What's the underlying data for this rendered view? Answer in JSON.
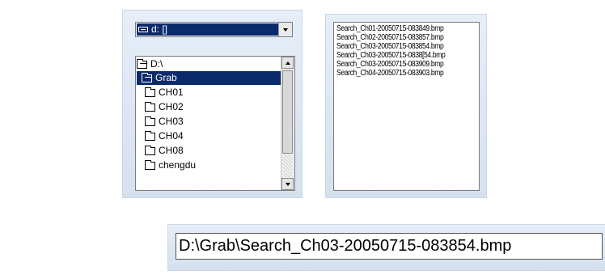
{
  "drive_combo": {
    "value": "d: []"
  },
  "folder_list": {
    "items": [
      {
        "label": "D:\\",
        "icon": "folder-open-icon",
        "selected": false
      },
      {
        "label": "Grab",
        "icon": "folder-open-icon",
        "selected": true
      },
      {
        "label": "CH01",
        "icon": "folder-icon",
        "selected": false
      },
      {
        "label": "CH02",
        "icon": "folder-icon",
        "selected": false
      },
      {
        "label": "CH03",
        "icon": "folder-icon",
        "selected": false
      },
      {
        "label": "CH04",
        "icon": "folder-icon",
        "selected": false
      },
      {
        "label": "CH08",
        "icon": "folder-icon",
        "selected": false
      },
      {
        "label": "chengdu",
        "icon": "folder-icon",
        "selected": false
      }
    ]
  },
  "file_list": {
    "items": [
      "Search_Ch01-20050715-083849.bmp",
      "Search_Ch02-20050715-083857.bmp",
      "Search_Ch03-20050715-083854.bmp",
      "Search_Ch03-20050715-0838[54.bmp",
      "Search_Ch03-20050715-083909.bmp",
      "Search_Ch04-20050715-083903.bmp"
    ]
  },
  "path_field": {
    "value": "D:\\Grab\\Search_Ch03-20050715-083854.bmp"
  },
  "colors": {
    "selection": "#0a2a6b",
    "panel_background": "#dbe6f3"
  }
}
